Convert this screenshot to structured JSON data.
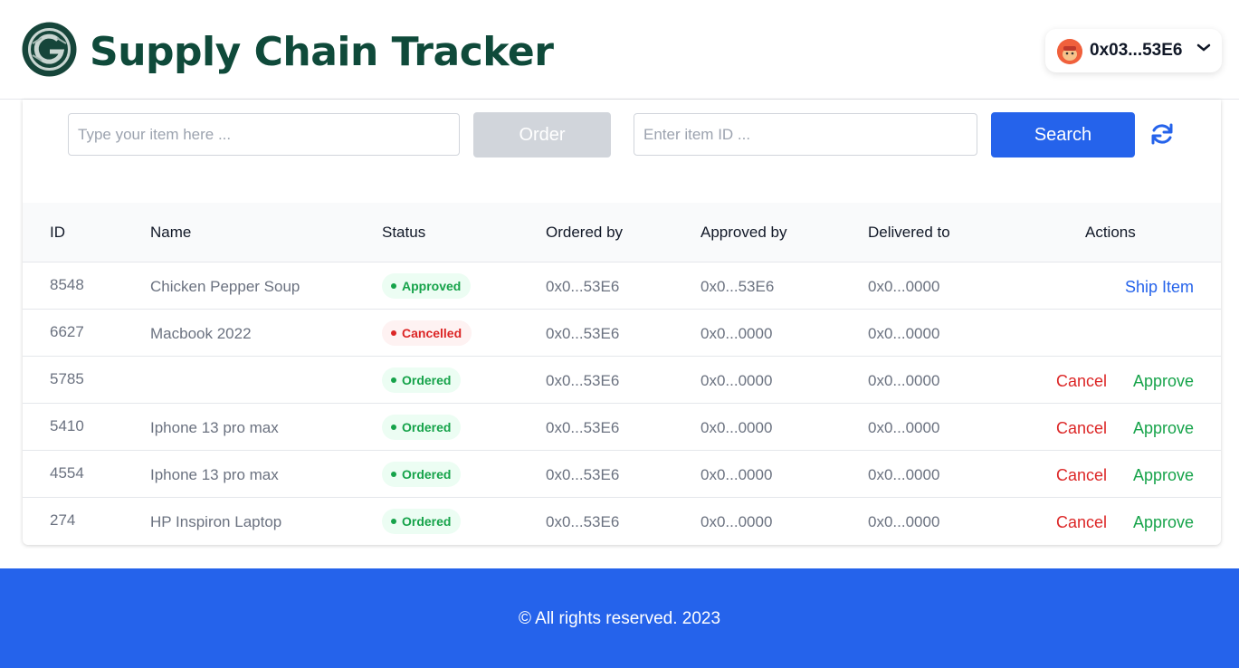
{
  "header": {
    "title": "Supply Chain Tracker",
    "wallet_address": "0x03...53E6"
  },
  "toolbar": {
    "item_placeholder": "Type your item here ...",
    "order_label": "Order",
    "id_placeholder": "Enter item ID ...",
    "search_label": "Search"
  },
  "table": {
    "headers": {
      "id": "ID",
      "name": "Name",
      "status": "Status",
      "ordered_by": "Ordered by",
      "approved_by": "Approved by",
      "delivered_to": "Delivered to",
      "actions": "Actions"
    },
    "rows": [
      {
        "id": "8548",
        "name": "Chicken Pepper Soup",
        "status": "Approved",
        "ordered_by": "0x0...53E6",
        "approved_by": "0x0...53E6",
        "delivered_to": "0x0...0000",
        "actions": [
          "Ship Item"
        ]
      },
      {
        "id": "6627",
        "name": "Macbook 2022",
        "status": "Cancelled",
        "ordered_by": "0x0...53E6",
        "approved_by": "0x0...0000",
        "delivered_to": "0x0...0000",
        "actions": []
      },
      {
        "id": "5785",
        "name": "",
        "status": "Ordered",
        "ordered_by": "0x0...53E6",
        "approved_by": "0x0...0000",
        "delivered_to": "0x0...0000",
        "actions": [
          "Cancel",
          "Approve"
        ]
      },
      {
        "id": "5410",
        "name": "Iphone 13 pro max",
        "status": "Ordered",
        "ordered_by": "0x0...53E6",
        "approved_by": "0x0...0000",
        "delivered_to": "0x0...0000",
        "actions": [
          "Cancel",
          "Approve"
        ]
      },
      {
        "id": "4554",
        "name": "Iphone 13 pro max",
        "status": "Ordered",
        "ordered_by": "0x0...53E6",
        "approved_by": "0x0...0000",
        "delivered_to": "0x0...0000",
        "actions": [
          "Cancel",
          "Approve"
        ]
      },
      {
        "id": "274",
        "name": "HP Inspiron Laptop",
        "status": "Ordered",
        "ordered_by": "0x0...53E6",
        "approved_by": "0x0...0000",
        "delivered_to": "0x0...0000",
        "actions": [
          "Cancel",
          "Approve"
        ]
      }
    ]
  },
  "footer": {
    "text": "© All rights reserved. 2023"
  },
  "colors": {
    "brand_dark_green": "#0f4a3a",
    "primary_blue": "#2563eb",
    "approved_green": "#16a34a",
    "cancelled_red": "#dc2626",
    "disabled_gray": "#d1d5db"
  },
  "icons": {
    "logo": "supply-chain-logo-icon",
    "wallet_avatar": "wallet-avatar-icon",
    "wallet_menu": "chevron-down-icon",
    "refresh": "refresh-icon"
  }
}
